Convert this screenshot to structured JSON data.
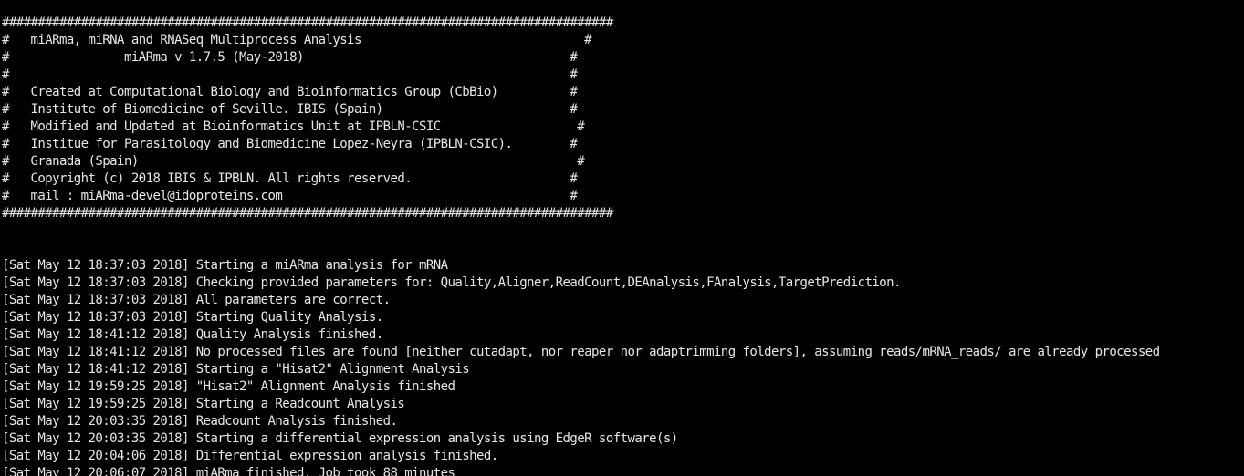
{
  "banner": [
    "#####################################################################################",
    "#   miARma, miRNA and RNASeq Multiprocess Analysis                               #",
    "#                miARma v 1.7.5 (May-2018)                                     #",
    "#                                                                              #",
    "#   Created at Computational Biology and Bioinformatics Group (CbBio)          #",
    "#   Institute of Biomedicine of Seville. IBIS (Spain)                          #",
    "#   Modified and Updated at Bioinformatics Unit at IPBLN-CSIC                   #",
    "#   Institue for Parasitology and Biomedicine Lopez-Neyra (IPBLN-CSIC).        #",
    "#   Granada (Spain)                                                             #",
    "#   Copyright (c) 2018 IBIS & IPBLN. All rights reserved.                      #",
    "#   mail : miARma-devel@idoproteins.com                                        #",
    "#####################################################################################"
  ],
  "log": [
    "[Sat May 12 18:37:03 2018] Starting a miARma analysis for mRNA",
    "[Sat May 12 18:37:03 2018] Checking provided parameters for: Quality,Aligner,ReadCount,DEAnalysis,FAnalysis,TargetPrediction.",
    "[Sat May 12 18:37:03 2018] All parameters are correct.",
    "[Sat May 12 18:37:03 2018] Starting Quality Analysis.",
    "[Sat May 12 18:41:12 2018] Quality Analysis finished.",
    "[Sat May 12 18:41:12 2018] No processed files are found [neither cutadapt, nor reaper nor adaptrimming folders], assuming reads/mRNA_reads/ are already processed",
    "[Sat May 12 18:41:12 2018] Starting a \"Hisat2\" Alignment Analysis",
    "[Sat May 12 19:59:25 2018] \"Hisat2\" Alignment Analysis finished",
    "[Sat May 12 19:59:25 2018] Starting a Readcount Analysis",
    "[Sat May 12 20:03:35 2018] Readcount Analysis finished.",
    "[Sat May 12 20:03:35 2018] Starting a differential expression analysis using EdgeR software(s)",
    "[Sat May 12 20:04:06 2018] Differential expression analysis finished.",
    "[Sat May 12 20:06:07 2018] miARma finished. Job took 88 minutes"
  ]
}
